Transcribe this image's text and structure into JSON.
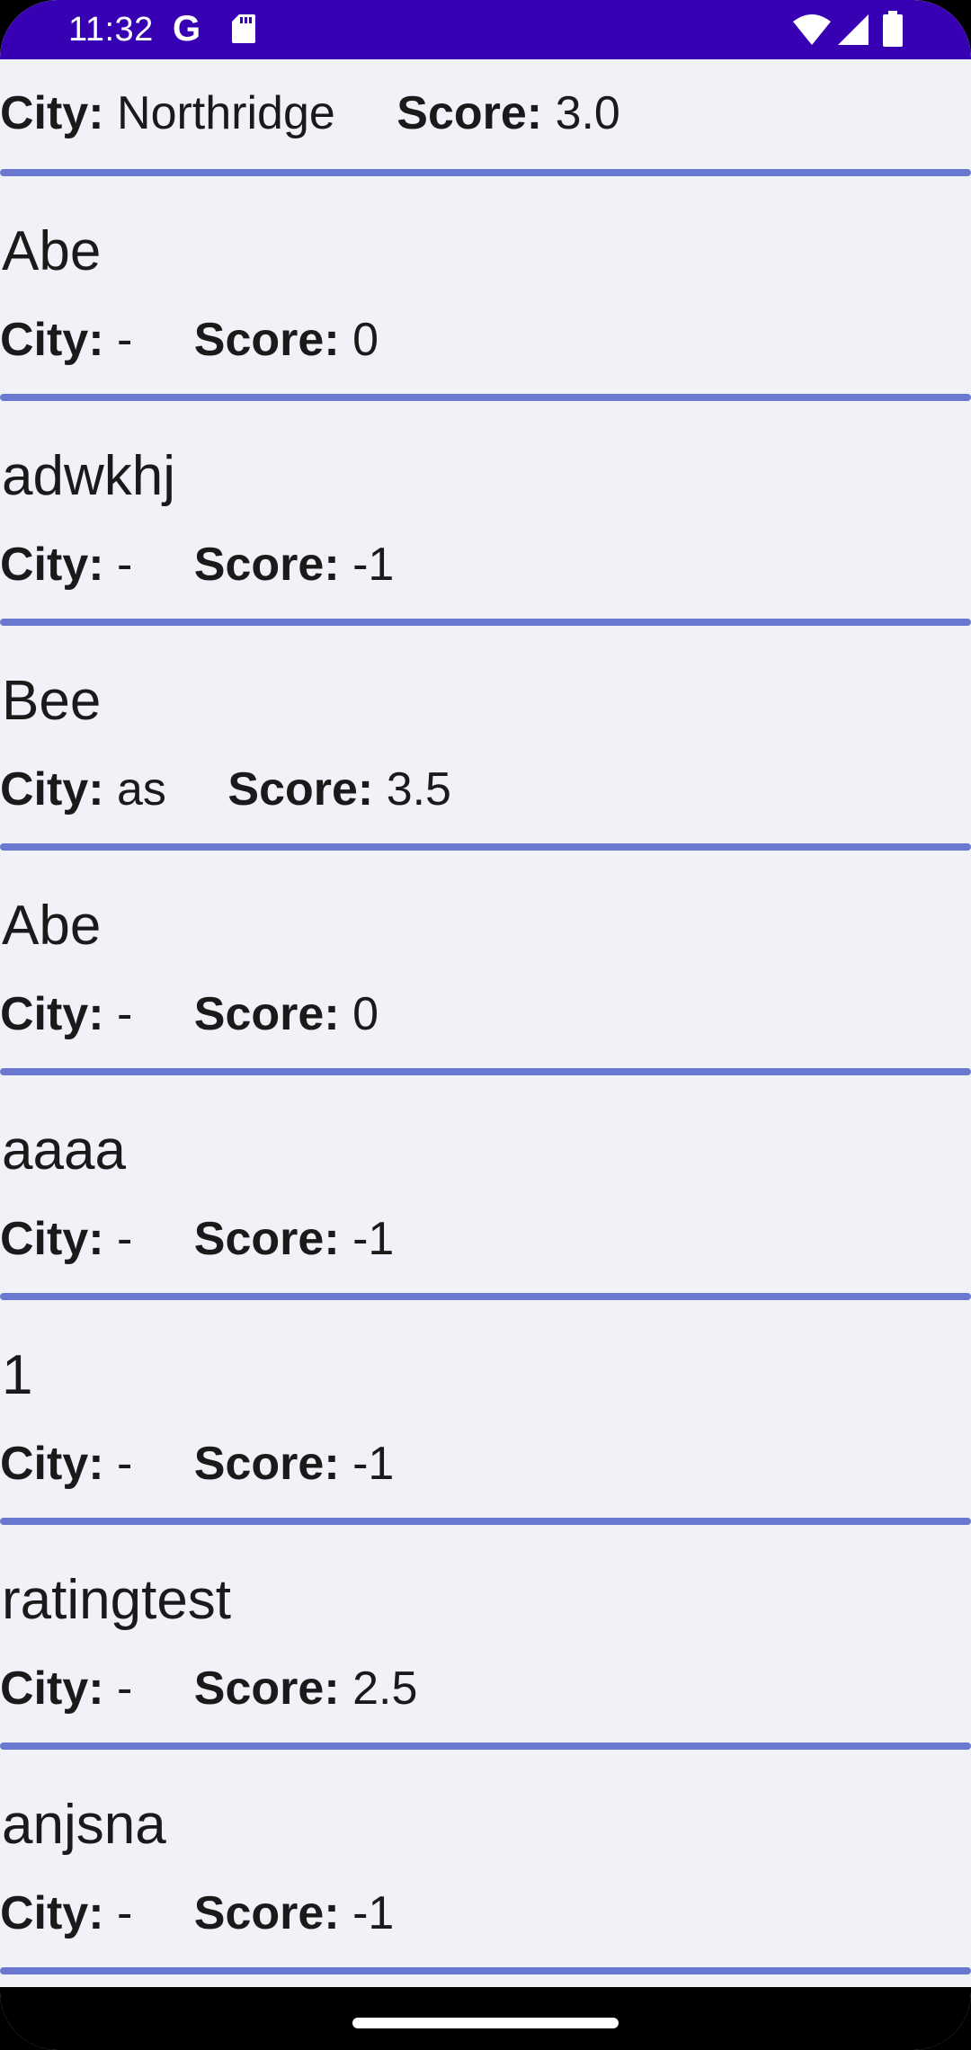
{
  "status_bar": {
    "time": "11:32",
    "g_label": "G",
    "icons": [
      "google-icon",
      "sd-card-icon",
      "wifi-icon",
      "signal-icon",
      "battery-icon"
    ]
  },
  "labels": {
    "city": "City:",
    "score": "Score:"
  },
  "head_row": {
    "city": "Northridge",
    "score": "3.0"
  },
  "items": [
    {
      "name": "Abe",
      "city": "-",
      "score": "0"
    },
    {
      "name": "adwkhj",
      "city": "-",
      "score": "-1"
    },
    {
      "name": "Bee",
      "city": "as",
      "score": "3.5"
    },
    {
      "name": "Abe",
      "city": "-",
      "score": "0"
    },
    {
      "name": "aaaa",
      "city": "-",
      "score": "-1"
    },
    {
      "name": "1",
      "city": "-",
      "score": "-1"
    },
    {
      "name": "ratingtest",
      "city": "-",
      "score": "2.5"
    },
    {
      "name": "anjsna",
      "city": "-",
      "score": "-1"
    }
  ],
  "colors": {
    "status_bar": "#3700b3",
    "background": "#f1f1f8",
    "divider": "#6b78d0"
  }
}
